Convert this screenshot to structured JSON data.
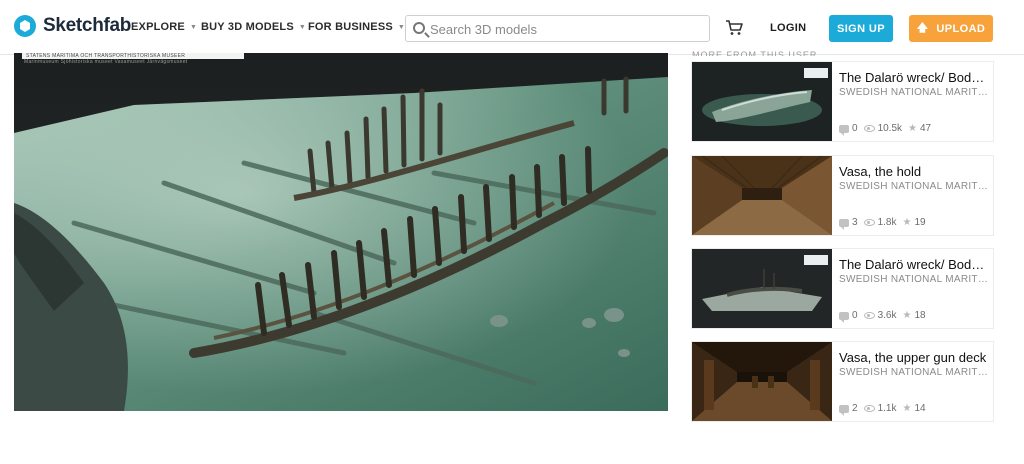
{
  "brand": {
    "name": "Sketchfab",
    "color": "#1caad9"
  },
  "nav": {
    "explore": "EXPLORE",
    "buy": "BUY 3D MODELS",
    "business": "FOR BUSINESS"
  },
  "search": {
    "placeholder": "Search 3D models"
  },
  "header": {
    "login": "LOGIN",
    "signup": "SIGN UP",
    "upload": "UPLOAD",
    "signup_color": "#1caad9",
    "upload_color": "#f7a23b"
  },
  "viewer": {
    "banner_text": "STATENS MARITIMA OCH TRANSPORTHISTORISKA MUSEER",
    "sub_text": "Marinmuseum    Sjöhistoriska museet    Vasamuseet    Järnvägsmuseet",
    "icon": "3d-model-viewer"
  },
  "sidebar": {
    "heading": "MORE FROM THIS USER",
    "cards": [
      {
        "title": "The Dalarö wreck/ Bodek...",
        "author": "SWEDISH NATIONAL MARITIM...",
        "comments": "0",
        "views": "10.5k",
        "likes": "47",
        "thumb": "dark-shipwreck"
      },
      {
        "title": "Vasa, the hold",
        "author": "SWEDISH NATIONAL MARITIM...",
        "comments": "3",
        "views": "1.8k",
        "likes": "19",
        "thumb": "wooden-hold"
      },
      {
        "title": "The Dalarö wreck/ Bodek...",
        "author": "SWEDISH NATIONAL MARITIM...",
        "comments": "0",
        "views": "3.6k",
        "likes": "18",
        "thumb": "dark-shipwreck-seabed"
      },
      {
        "title": "Vasa, the upper gun deck",
        "author": "SWEDISH NATIONAL MARITIM...",
        "comments": "2",
        "views": "1.1k",
        "likes": "14",
        "thumb": "gun-deck"
      }
    ]
  }
}
